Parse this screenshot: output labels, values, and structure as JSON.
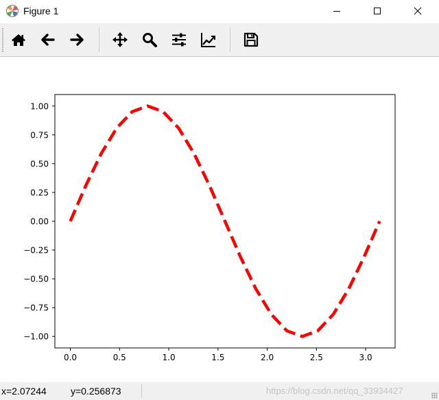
{
  "window": {
    "title": "Figure 1",
    "controls": [
      "minimize",
      "maximize",
      "close"
    ]
  },
  "toolbar": {
    "buttons": [
      {
        "name": "home",
        "icon": "home-icon"
      },
      {
        "name": "back",
        "icon": "arrow-left-icon"
      },
      {
        "name": "forward",
        "icon": "arrow-right-icon"
      },
      {
        "name": "pan",
        "icon": "move-icon"
      },
      {
        "name": "zoom",
        "icon": "magnifier-icon"
      },
      {
        "name": "subplots",
        "icon": "sliders-icon"
      },
      {
        "name": "edit-axes",
        "icon": "line-chart-icon"
      },
      {
        "name": "save",
        "icon": "floppy-disk-icon"
      }
    ]
  },
  "status": {
    "x_readout": "x=2.07244",
    "y_readout": "y=0.256873",
    "watermark": "https://blog.csdn.net/qq_33934427"
  },
  "chart_data": {
    "type": "line",
    "title": "",
    "xlabel": "",
    "ylabel": "",
    "xlim": [
      -0.157,
      3.299
    ],
    "ylim": [
      -1.1,
      1.1
    ],
    "xticks": [
      0.0,
      0.5,
      1.0,
      1.5,
      2.0,
      2.5,
      3.0
    ],
    "xtick_labels": [
      "0.0",
      "0.5",
      "1.0",
      "1.5",
      "2.0",
      "2.5",
      "3.0"
    ],
    "yticks": [
      1.0,
      0.75,
      0.5,
      0.25,
      0.0,
      -0.25,
      -0.5,
      -0.75,
      -1.0
    ],
    "ytick_labels": [
      "1.00",
      "0.75",
      "0.50",
      "0.25",
      "0.00",
      "−0.25",
      "−0.50",
      "−0.75",
      "−1.00"
    ],
    "grid": false,
    "series": [
      {
        "color": "#ff0000",
        "linestyle": "dashed",
        "x": [
          0.0,
          0.1571,
          0.3142,
          0.4712,
          0.6283,
          0.7854,
          0.9425,
          1.0996,
          1.2566,
          1.4137,
          1.5708,
          1.7279,
          1.885,
          2.042,
          2.1991,
          2.3562,
          2.5133,
          2.6704,
          2.8274,
          2.9845,
          3.1416
        ],
        "y": [
          0.0,
          0.309,
          0.588,
          0.809,
          0.951,
          1.0,
          0.951,
          0.809,
          0.588,
          0.309,
          0.0,
          -0.309,
          -0.588,
          -0.809,
          -0.951,
          -1.0,
          -0.951,
          -0.809,
          -0.588,
          -0.309,
          0.0
        ]
      }
    ]
  }
}
